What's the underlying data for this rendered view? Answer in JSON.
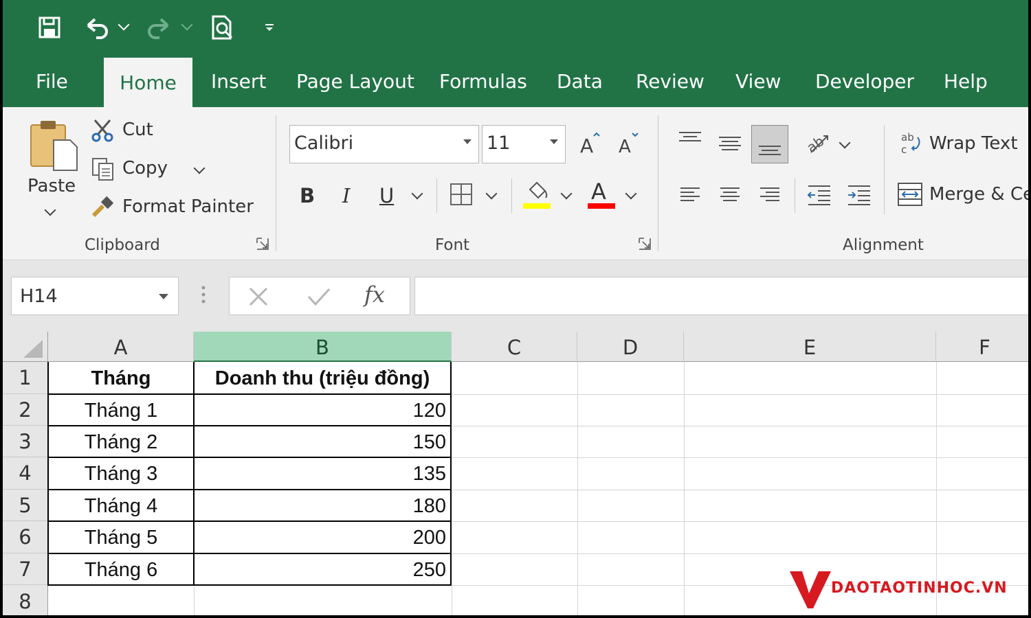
{
  "qat": {
    "save_icon": "save-icon",
    "undo_icon": "undo-icon",
    "redo_icon": "redo-icon",
    "print_preview_icon": "print-preview-icon",
    "customize_icon": "customize-qat-icon"
  },
  "tabs": [
    {
      "label": "File"
    },
    {
      "label": "Home",
      "active": true
    },
    {
      "label": "Insert"
    },
    {
      "label": "Page Layout"
    },
    {
      "label": "Formulas"
    },
    {
      "label": "Data"
    },
    {
      "label": "Review"
    },
    {
      "label": "View"
    },
    {
      "label": "Developer"
    },
    {
      "label": "Help"
    }
  ],
  "ribbon": {
    "clipboard": {
      "paste": "Paste",
      "cut": "Cut",
      "copy": "Copy",
      "format_painter": "Format Painter",
      "group_label": "Clipboard"
    },
    "font": {
      "font_name": "Calibri",
      "font_size": "11",
      "bold": "B",
      "italic": "I",
      "underline": "U",
      "group_label": "Font",
      "highlight_color": "#ffff00",
      "font_color": "#ff0000"
    },
    "alignment": {
      "wrap_text": "Wrap Text",
      "merge": "Merge & Ce",
      "group_label": "Alignment"
    }
  },
  "formula_bar": {
    "name_box": "H14",
    "fx": "fx",
    "formula": ""
  },
  "sheet": {
    "columns": [
      "A",
      "B",
      "C",
      "D",
      "E",
      "F"
    ],
    "selected_column": "B",
    "rows": [
      "1",
      "2",
      "3",
      "4",
      "5",
      "6",
      "7",
      "8"
    ],
    "header": {
      "a": "Tháng",
      "b": "Doanh thu (triệu đồng)"
    },
    "data": [
      {
        "a": "Tháng 1",
        "b": "120"
      },
      {
        "a": "Tháng 2",
        "b": "150"
      },
      {
        "a": "Tháng 3",
        "b": "135"
      },
      {
        "a": "Tháng 4",
        "b": "180"
      },
      {
        "a": "Tháng 5",
        "b": "200"
      },
      {
        "a": "Tháng 6",
        "b": "250"
      }
    ]
  },
  "watermark": {
    "text": "DAOTAOTINHOC.VN",
    "color": "#d71920"
  },
  "colors": {
    "excel_green": "#217346",
    "selected_header": "#a0d8b9"
  }
}
